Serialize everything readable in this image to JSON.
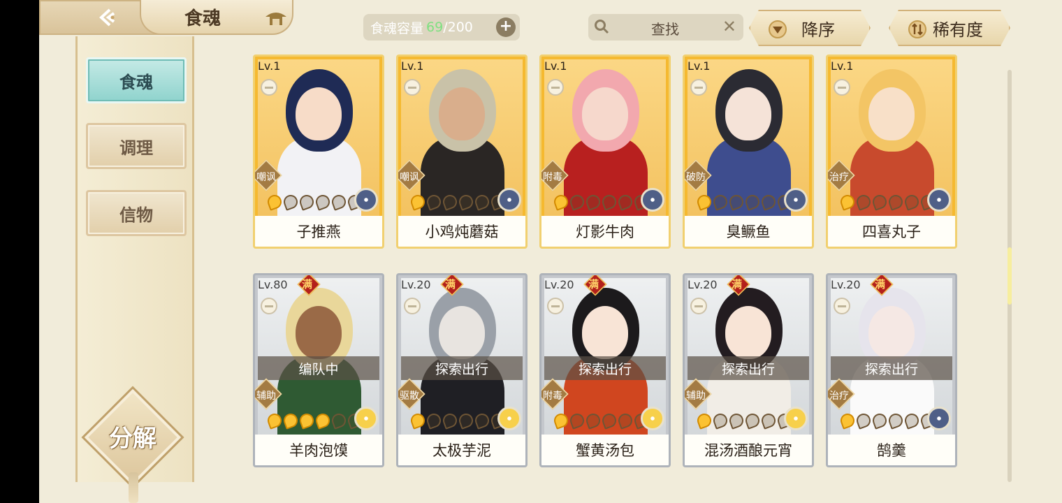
{
  "header": {
    "title": "食魂",
    "capacity_label": "食魂容量",
    "capacity_current": "69",
    "capacity_total": "/200",
    "search_placeholder": "查找",
    "sort_order_label": "降序",
    "sort_key_label": "稀有度"
  },
  "sidebar": {
    "tabs": [
      {
        "label": "食魂",
        "active": true
      },
      {
        "label": "调理",
        "active": false
      },
      {
        "label": "信物",
        "active": false
      }
    ],
    "decompose_label": "分解"
  },
  "cards": [
    {
      "name": "子推燕",
      "level": "Lv.1",
      "role": "嘲讽",
      "rarity": "gold",
      "stars": 1,
      "emblem": "blue",
      "maxed": false,
      "status": "",
      "colors": {
        "hair": "#1f2b55",
        "skin": "#f7dcc8",
        "cloth": "#f2f2f5"
      }
    },
    {
      "name": "小鸡炖蘑菇",
      "level": "Lv.1",
      "role": "嘲讽",
      "rarity": "gold",
      "stars": 1,
      "emblem": "blue",
      "maxed": false,
      "status": "",
      "colors": {
        "hair": "#c9c2a8",
        "skin": "#d9ae8c",
        "cloth": "#2a2624"
      }
    },
    {
      "name": "灯影牛肉",
      "level": "Lv.1",
      "role": "附毒",
      "rarity": "gold",
      "stars": 1,
      "emblem": "blue",
      "maxed": false,
      "status": "",
      "colors": {
        "hair": "#f2a8ae",
        "skin": "#f6d8cc",
        "cloth": "#b8201f"
      }
    },
    {
      "name": "臭鳜鱼",
      "level": "Lv.1",
      "role": "破防",
      "rarity": "gold",
      "stars": 1,
      "emblem": "blue",
      "maxed": false,
      "status": "",
      "colors": {
        "hair": "#2b2b33",
        "skin": "#f5e3d8",
        "cloth": "#3e4d8e"
      }
    },
    {
      "name": "四喜丸子",
      "level": "Lv.1",
      "role": "治疗",
      "rarity": "gold",
      "stars": 1,
      "emblem": "blue",
      "maxed": false,
      "status": "",
      "colors": {
        "hair": "#f3c565",
        "skin": "#f8e0c8",
        "cloth": "#c84a2d"
      }
    },
    {
      "name": "羊肉泡馍",
      "level": "Lv.80",
      "role": "辅助",
      "rarity": "silver",
      "stars": 4,
      "emblem": "gold",
      "maxed": true,
      "status": "编队中",
      "colors": {
        "hair": "#e9d79a",
        "skin": "#9a6a47",
        "cloth": "#2f5a33"
      }
    },
    {
      "name": "太极芋泥",
      "level": "Lv.20",
      "role": "驱散",
      "rarity": "silver",
      "stars": 1,
      "emblem": "gold",
      "maxed": true,
      "status": "探索出行",
      "colors": {
        "hair": "#9aa0a8",
        "skin": "#e8e4e0",
        "cloth": "#1f1f24"
      }
    },
    {
      "name": "蟹黄汤包",
      "level": "Lv.20",
      "role": "附毒",
      "rarity": "silver",
      "stars": 1,
      "emblem": "gold",
      "maxed": true,
      "status": "探索出行",
      "colors": {
        "hair": "#1c1a1c",
        "skin": "#f8e4d6",
        "cloth": "#d0461f"
      }
    },
    {
      "name": "混汤酒酿元宵",
      "level": "Lv.20",
      "role": "辅助",
      "rarity": "silver",
      "stars": 1,
      "emblem": "gold",
      "maxed": true,
      "status": "探索出行",
      "colors": {
        "hair": "#231c20",
        "skin": "#f8e4d6",
        "cloth": "#f1ede6"
      }
    },
    {
      "name": "鹄羹",
      "level": "Lv.20",
      "role": "治疗",
      "rarity": "silver",
      "stars": 1,
      "emblem": "blue",
      "maxed": true,
      "status": "探索出行",
      "colors": {
        "hair": "#e6e4ec",
        "skin": "#f5e8e4",
        "cloth": "#fafafa"
      }
    }
  ],
  "maxed_badge": "满",
  "colors": {
    "accent_teal": "#8fd3cd",
    "card_gold": "#f5b930",
    "card_silver": "#c4c7cc",
    "capacity_green": "#7ee080"
  }
}
